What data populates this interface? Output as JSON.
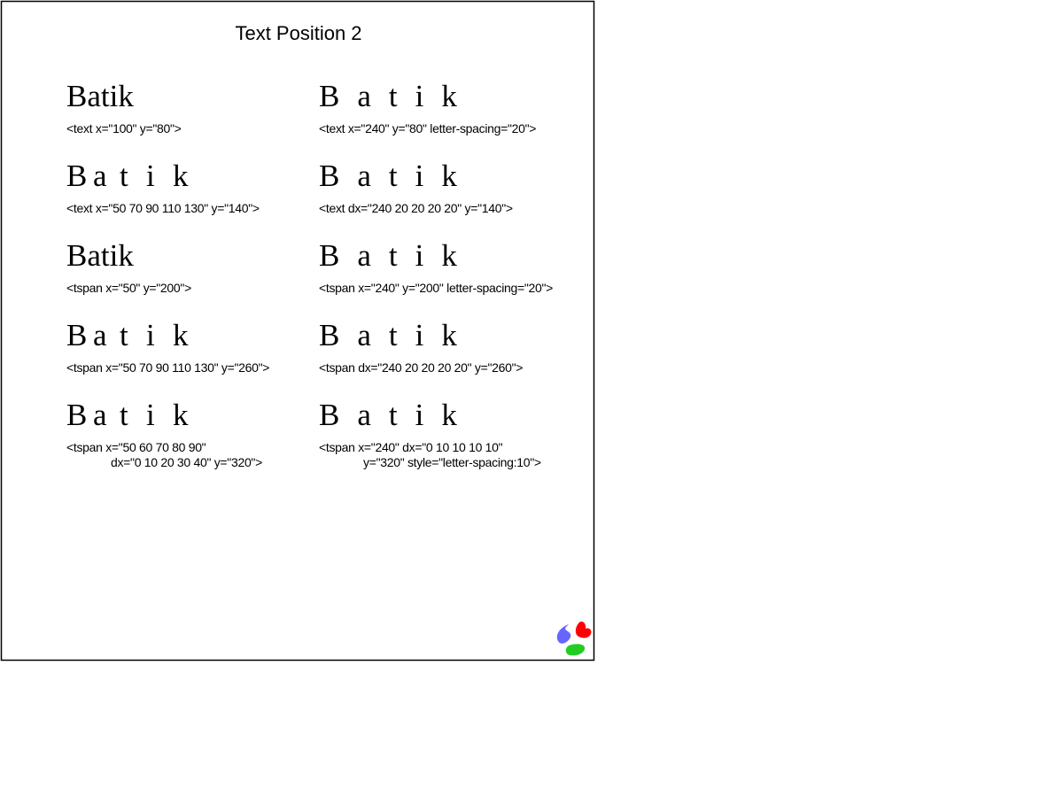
{
  "title": "Text Position 2",
  "demo_word": "Batik",
  "cells": [
    {
      "caption": [
        "<text x=\"100\" y=\"80\">"
      ]
    },
    {
      "caption": [
        "<text x=\"240\" y=\"80\" letter-spacing=\"20\">"
      ]
    },
    {
      "caption": [
        "<text x=\"50 70 90 110 130\" y=\"140\">"
      ]
    },
    {
      "caption": [
        "<text dx=\"240 20 20 20 20\" y=\"140\">"
      ]
    },
    {
      "caption": [
        "<tspan x=\"50\" y=\"200\">"
      ]
    },
    {
      "caption": [
        "<tspan x=\"240\" y=\"200\" letter-spacing=\"20\">"
      ]
    },
    {
      "caption": [
        "<tspan x=\"50 70 90 110 130\" y=\"260\">"
      ]
    },
    {
      "caption": [
        "<tspan dx=\"240 20 20 20 20\" y=\"260\">"
      ]
    },
    {
      "caption": [
        "<tspan x=\"50 60 70 80 90\"",
        "dx=\"0 10 20 30 40\" y=\"320\">"
      ]
    },
    {
      "caption": [
        "<tspan x=\"240\" dx=\"0 10 10 10 10\"",
        "y=\"320\" style=\"letter-spacing:10\">"
      ]
    }
  ],
  "colors": {
    "border": "#000000",
    "logo_blue": "#6666ff",
    "logo_red": "#ff0000",
    "logo_green": "#22cc22"
  },
  "logo_icon": "batik-logo-icon"
}
